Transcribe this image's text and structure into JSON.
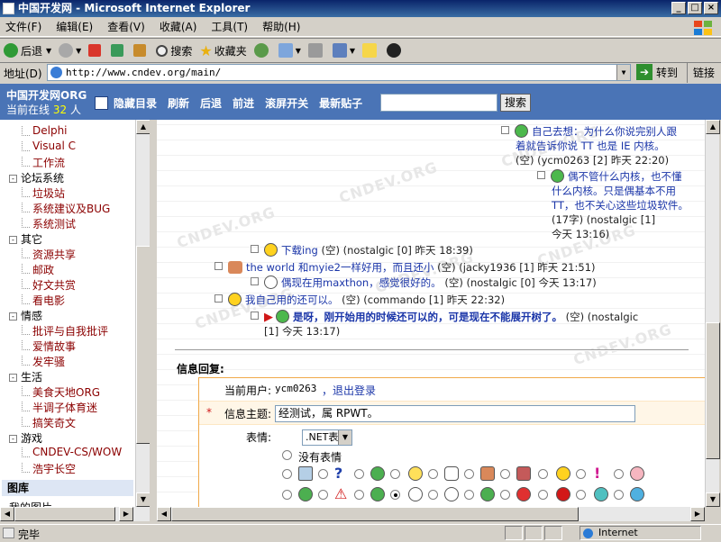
{
  "window": {
    "title": "中国开发网 - Microsoft Internet Explorer",
    "min": "_",
    "max": "□",
    "close": "×"
  },
  "menu": [
    "文件(F)",
    "编辑(E)",
    "查看(V)",
    "收藏(A)",
    "工具(T)",
    "帮助(H)"
  ],
  "toolbar": {
    "back": "后退",
    "search": "搜索",
    "favorites": "收藏夹"
  },
  "address": {
    "label": "地址(D)",
    "url": "http://www.cndev.org/main/",
    "go": "转到",
    "links": "链接"
  },
  "site": {
    "name": "中国开发网ORG",
    "online_prefix": "当前在线",
    "online_count": "32",
    "online_suffix": "人",
    "nav": [
      "隐藏目录",
      "刷新",
      "后退",
      "前进",
      "滚屏开关",
      "最新贴子"
    ],
    "search_button": "搜索"
  },
  "sidebar": {
    "items": [
      {
        "text": "Delphi",
        "type": "sub"
      },
      {
        "text": "Visual C",
        "type": "sub"
      },
      {
        "text": "工作流",
        "type": "sub"
      },
      {
        "text": "论坛系统",
        "type": "group"
      },
      {
        "text": "垃圾站",
        "type": "sub"
      },
      {
        "text": "系统建议及BUG",
        "type": "sub"
      },
      {
        "text": "系统测试",
        "type": "sub"
      },
      {
        "text": "其它",
        "type": "group"
      },
      {
        "text": "资源共享",
        "type": "sub"
      },
      {
        "text": "邮政",
        "type": "sub"
      },
      {
        "text": "好文共赏",
        "type": "sub"
      },
      {
        "text": "看电影",
        "type": "sub"
      },
      {
        "text": "情感",
        "type": "group"
      },
      {
        "text": "批评与自我批评",
        "type": "sub"
      },
      {
        "text": "爱情故事",
        "type": "sub"
      },
      {
        "text": "发牢骚",
        "type": "sub"
      },
      {
        "text": "生活",
        "type": "group"
      },
      {
        "text": "美食天地ORG",
        "type": "sub"
      },
      {
        "text": "半调子体育迷",
        "type": "sub"
      },
      {
        "text": "搞笑奇文",
        "type": "sub"
      },
      {
        "text": "游戏",
        "type": "group"
      },
      {
        "text": "CNDEV-CS/WOW",
        "type": "sub"
      },
      {
        "text": "浩宇长空",
        "type": "sub"
      }
    ],
    "gallery": "图库",
    "cut_item": "我的图片"
  },
  "watermark": "CNDEV.ORG",
  "posts": [
    {
      "title": "自己去想：为什么你说完别人跟",
      "line2": "着就告诉你说 TT 也是 IE 内核。",
      "meta": "(空) (ycm0263 [2] 昨天 22:20)"
    },
    {
      "title": "偶不管什么内核，也不懂",
      "line2": "什么内核。只是偶基本不用",
      "line3": "TT，也不关心这些垃圾软件。",
      "meta1": "(17字) (nostalgic [1]",
      "meta2": "今天 13:16)"
    },
    {
      "title": "下载ing",
      "meta": "(空) (nostalgic [0] 昨天 18:39)"
    },
    {
      "title": "the world 和myie2一样好用，而且还小",
      "meta": "(空) (jacky1936 [1] 昨天 21:51)"
    },
    {
      "title": "偶现在用maxthon，感觉很好的。",
      "meta": "(空) (nostalgic [0] 今天 13:17)"
    },
    {
      "title": "我自己用的还可以。",
      "meta": "(空) (commando [1] 昨天 22:32)"
    },
    {
      "title": "是呀，刚开始用的时候还可以的，可是现在不能展开树了。",
      "meta": "(空) (nostalgic",
      "meta2": "[1] 今天 13:17)"
    }
  ],
  "reply": {
    "heading": "信息回复:",
    "current_user_label": "当前用户:",
    "current_user": "ycm0263",
    "logout": "，退出登录",
    "subject_label": "信息主题:",
    "subject_value": "经测试，属 RPWT。",
    "emote_label": "表情:",
    "emote_select": ".NET表情",
    "no_emote": "没有表情"
  },
  "status": {
    "text": "完毕",
    "zone": "Internet"
  }
}
